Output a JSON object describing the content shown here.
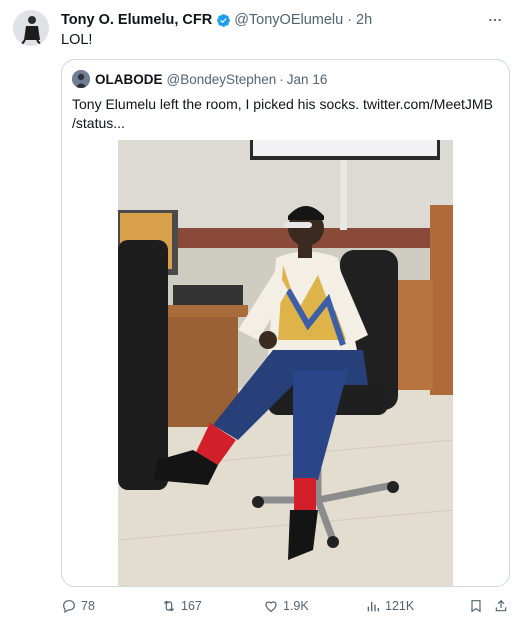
{
  "tweet": {
    "author_name": "Tony O. Elumelu, CFR",
    "handle": "@TonyOElumelu",
    "separator": "·",
    "time": "2h",
    "text": "LOL!"
  },
  "quote": {
    "author_name": "OLABODE",
    "handle": "@BondeyStephen",
    "separator": "·",
    "date": "Jan 16",
    "text_line1": "Tony Elumelu left the room, I picked his socks.  twitter.com/MeetJMB",
    "text_line2": "/status..."
  },
  "actions": {
    "replies": "78",
    "retweets": "167",
    "likes": "1.9K",
    "views": "121K"
  },
  "colors": {
    "verified": "#1d9bf0",
    "muted": "#536471",
    "border": "#cfd9de",
    "text": "#0f1419"
  },
  "icons": [
    "verified-badge-icon",
    "more-icon",
    "reply-icon",
    "retweet-icon",
    "like-icon",
    "views-icon",
    "bookmark-icon",
    "share-icon"
  ]
}
